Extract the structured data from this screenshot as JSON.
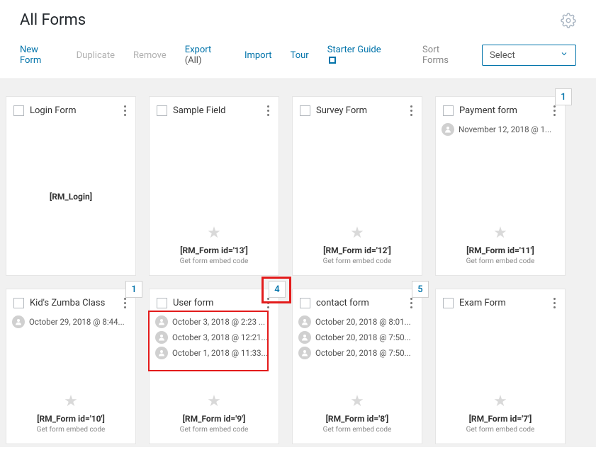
{
  "header": {
    "title": "All Forms"
  },
  "toolbar": {
    "new_form": "New Form",
    "duplicate": "Duplicate",
    "remove": "Remove",
    "export": "Export",
    "export_suffix": "(All)",
    "import": "Import",
    "tour": "Tour",
    "starter_guide": "Starter Guide",
    "sort_label": "Sort Forms",
    "sort_select": "Select"
  },
  "cards": [
    {
      "title": "Login Form",
      "badge": null,
      "entries": [],
      "short_center": "[RM_Login]",
      "shortcode": null,
      "embed_label": null,
      "highlight": false
    },
    {
      "title": "Sample Field",
      "badge": null,
      "entries": [],
      "short_center": null,
      "shortcode": "[RM_Form id='13']",
      "embed_label": "Get form embed code",
      "highlight": false
    },
    {
      "title": "Survey Form",
      "badge": null,
      "entries": [],
      "short_center": null,
      "shortcode": "[RM_Form id='12']",
      "embed_label": "Get form embed code",
      "highlight": false
    },
    {
      "title": "Payment form",
      "badge": "1",
      "entries": [
        "November 12, 2018 @ 1..."
      ],
      "short_center": null,
      "shortcode": "[RM_Form id='11']",
      "embed_label": "Get form embed code",
      "highlight": false
    },
    {
      "title": "Kid's Zumba Class",
      "badge": "1",
      "entries": [
        "October 29, 2018 @ 8:44..."
      ],
      "short_center": null,
      "shortcode": "[RM_Form id='10']",
      "embed_label": "Get form embed code",
      "highlight": false
    },
    {
      "title": "User form",
      "badge": "4",
      "entries": [
        "October 3, 2018 @ 2:23 ...",
        "October 3, 2018 @ 12:21...",
        "October 1, 2018 @ 11:33..."
      ],
      "short_center": null,
      "shortcode": "[RM_Form id='9']",
      "embed_label": "Get form embed code",
      "highlight": true
    },
    {
      "title": "contact form",
      "badge": "5",
      "entries": [
        "October 20, 2018 @ 8:01...",
        "October 20, 2018 @ 7:50...",
        "October 20, 2018 @ 7:50..."
      ],
      "short_center": null,
      "shortcode": "[RM_Form id='8']",
      "embed_label": "Get form embed code",
      "highlight": false
    },
    {
      "title": "Exam Form",
      "badge": null,
      "entries": [],
      "short_center": null,
      "shortcode": "[RM_Form id='7']",
      "embed_label": "Get form embed code",
      "highlight": false
    }
  ]
}
